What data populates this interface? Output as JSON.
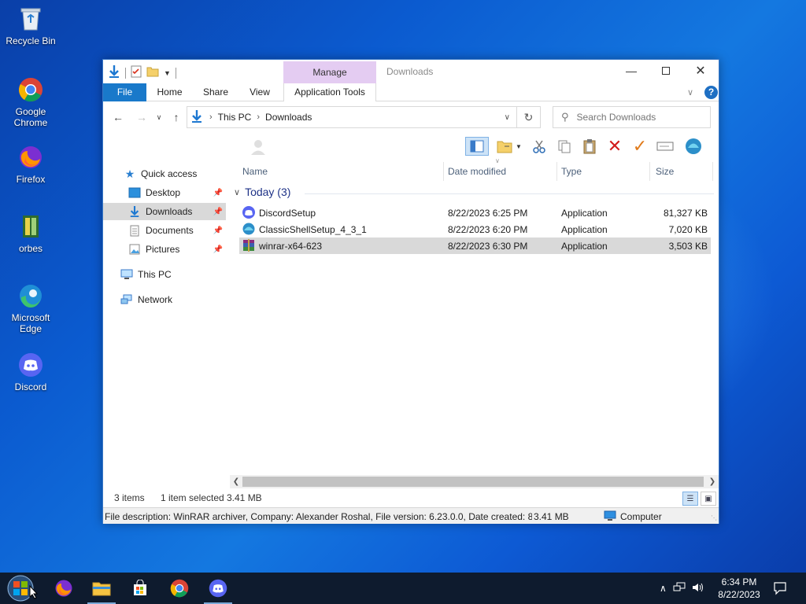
{
  "desktop": {
    "icons": [
      {
        "label": "Recycle Bin",
        "icon": "recycle-bin-icon"
      },
      {
        "label": "Google Chrome",
        "icon": "chrome-icon"
      },
      {
        "label": "Firefox",
        "icon": "firefox-icon"
      },
      {
        "label": "orbes",
        "icon": "orbes-icon"
      },
      {
        "label": "Microsoft Edge",
        "icon": "edge-icon"
      },
      {
        "label": "Discord",
        "icon": "discord-icon"
      }
    ]
  },
  "window": {
    "title": "Downloads",
    "manage_tab": "Manage",
    "ribbon_tabs": {
      "file": "File",
      "home": "Home",
      "share": "Share",
      "view": "View",
      "app_tools": "Application Tools"
    },
    "address": {
      "root": "This PC",
      "current": "Downloads"
    },
    "search": {
      "placeholder": "Search Downloads"
    },
    "nav_pane": {
      "quick_access": "Quick access",
      "desktop": "Desktop",
      "downloads": "Downloads",
      "documents": "Documents",
      "pictures": "Pictures",
      "this_pc": "This PC",
      "network": "Network"
    },
    "columns": {
      "name": "Name",
      "date": "Date modified",
      "type": "Type",
      "size": "Size"
    },
    "group": {
      "label": "Today (3)"
    },
    "files": [
      {
        "name": "DiscordSetup",
        "date": "8/22/2023 6:25 PM",
        "type": "Application",
        "size": "81,327 KB",
        "icon": "discord-icon"
      },
      {
        "name": "ClassicShellSetup_4_3_1",
        "date": "8/22/2023 6:20 PM",
        "type": "Application",
        "size": "7,020 KB",
        "icon": "classic-shell-icon"
      },
      {
        "name": "winrar-x64-623",
        "date": "8/22/2023 6:30 PM",
        "type": "Application",
        "size": "3,503 KB",
        "icon": "winrar-icon"
      }
    ],
    "status": {
      "items": "3 items",
      "selected": "1 item selected",
      "size": "3.41 MB"
    },
    "description": {
      "text": "File description: WinRAR archiver, Company: Alexander Roshal, File version: 6.23.0.0, Date created: 8/22/",
      "size": "3.41 MB",
      "location": "Computer"
    }
  },
  "taskbar": {
    "apps": [
      "start",
      "firefox",
      "file-explorer",
      "microsoft-store",
      "chrome",
      "discord"
    ],
    "clock": {
      "time": "6:34 PM",
      "date": "8/22/2023"
    }
  }
}
